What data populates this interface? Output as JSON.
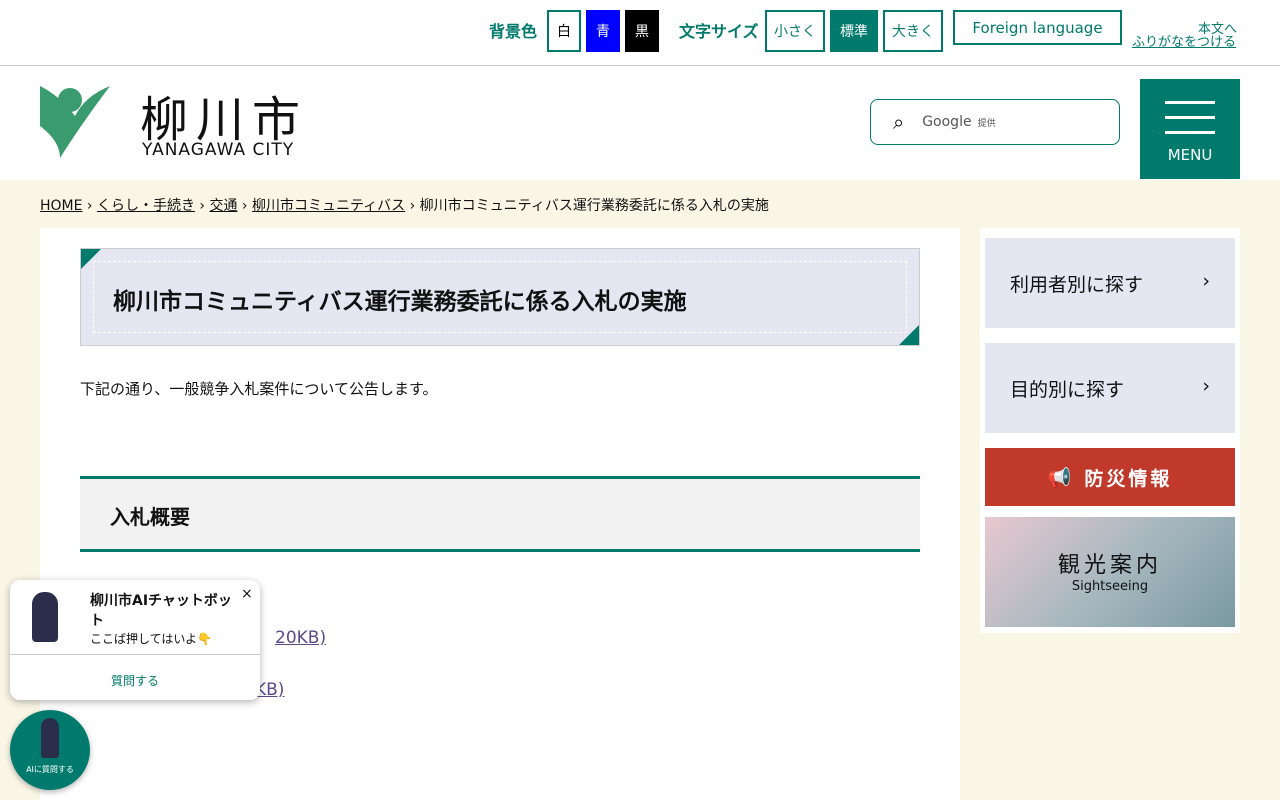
{
  "topbar": {
    "bg_label": "背景色",
    "bg_white": "白",
    "bg_blue": "青",
    "bg_black": "黒",
    "size_label": "文字サイズ",
    "size_small": "小さく",
    "size_normal": "標準",
    "size_large": "大きく",
    "foreign": "Foreign language",
    "skip": "本文へ",
    "furigana": "ふりがなをつける"
  },
  "header": {
    "logo_jp": "柳川市",
    "logo_en": "YANAGAWA CITY",
    "search_brand": "Google",
    "search_provided": "提供",
    "menu_label": "MENU"
  },
  "breadcrumb": [
    "HOME",
    "くらし・手続き",
    "交通",
    "柳川市コミュニティバス",
    "柳川市コミュニティバス運行業務委託に係る入札の実施"
  ],
  "main": {
    "title": "柳川市コミュニティバス運行業務委託に係る入札の実施",
    "intro": "下記の通り、一般競争入札案件について公告します。",
    "section": "入札概要",
    "links": [
      "20KB)",
      "KB)"
    ]
  },
  "sidebar": {
    "by_user": "利用者別に探す",
    "by_purpose": "目的別に探す",
    "disaster": "防災情報",
    "tourism_jp": "観光案内",
    "tourism_en": "Sightseeing"
  },
  "chat": {
    "title": "柳川市AIチャットボット",
    "message": "ここば押してはいよ👇",
    "ask": "質問する",
    "close": "×",
    "fab_label": "AIに質問する"
  },
  "colors": {
    "accent": "#007a6c",
    "disaster": "#c0392b",
    "blue": "#0000ff"
  }
}
